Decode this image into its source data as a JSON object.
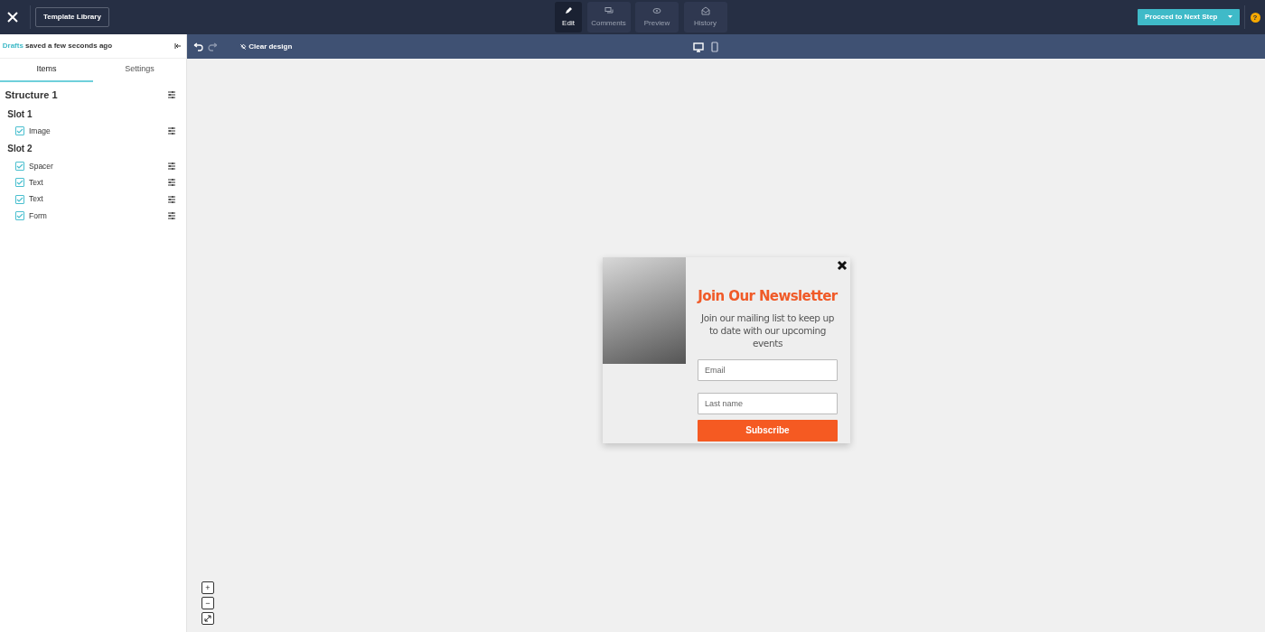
{
  "header": {
    "template_library": "Template Library",
    "mode_tabs": [
      {
        "kind": "edit",
        "label": "Edit",
        "selected": true
      },
      {
        "kind": "comments",
        "label": "Comments",
        "selected": false
      },
      {
        "kind": "preview",
        "label": "Preview",
        "selected": false
      },
      {
        "kind": "history",
        "label": "History",
        "selected": false
      }
    ],
    "proceed": "Proceed to Next Step",
    "help": "?"
  },
  "sidebar": {
    "drafts_link": "Drafts",
    "saved_text": "saved a few seconds ago",
    "tabs": [
      {
        "label": "Items",
        "selected": true
      },
      {
        "label": "Settings",
        "selected": false
      }
    ],
    "structure": {
      "title": "Structure 1",
      "slots": [
        {
          "title": "Slot 1",
          "items": [
            {
              "label": "Image",
              "checked": true
            }
          ]
        },
        {
          "title": "Slot 2",
          "items": [
            {
              "label": "Spacer",
              "checked": true
            },
            {
              "label": "Text",
              "checked": true
            },
            {
              "label": "Text",
              "checked": true
            },
            {
              "label": "Form",
              "checked": true
            }
          ]
        }
      ]
    }
  },
  "toolbar": {
    "clear_design": "Clear design",
    "devices": [
      {
        "kind": "desktop",
        "selected": true
      },
      {
        "kind": "mobile",
        "selected": false
      }
    ]
  },
  "popup": {
    "heading": "Join Our Newsletter",
    "body": "Join our mailing list to keep up to date with our upcoming events",
    "fields": [
      {
        "placeholder": "Email"
      },
      {
        "placeholder": "Last name"
      }
    ],
    "button": "Subscribe"
  },
  "zoom_controls": {
    "zoom_in": "+",
    "zoom_out": "−"
  }
}
